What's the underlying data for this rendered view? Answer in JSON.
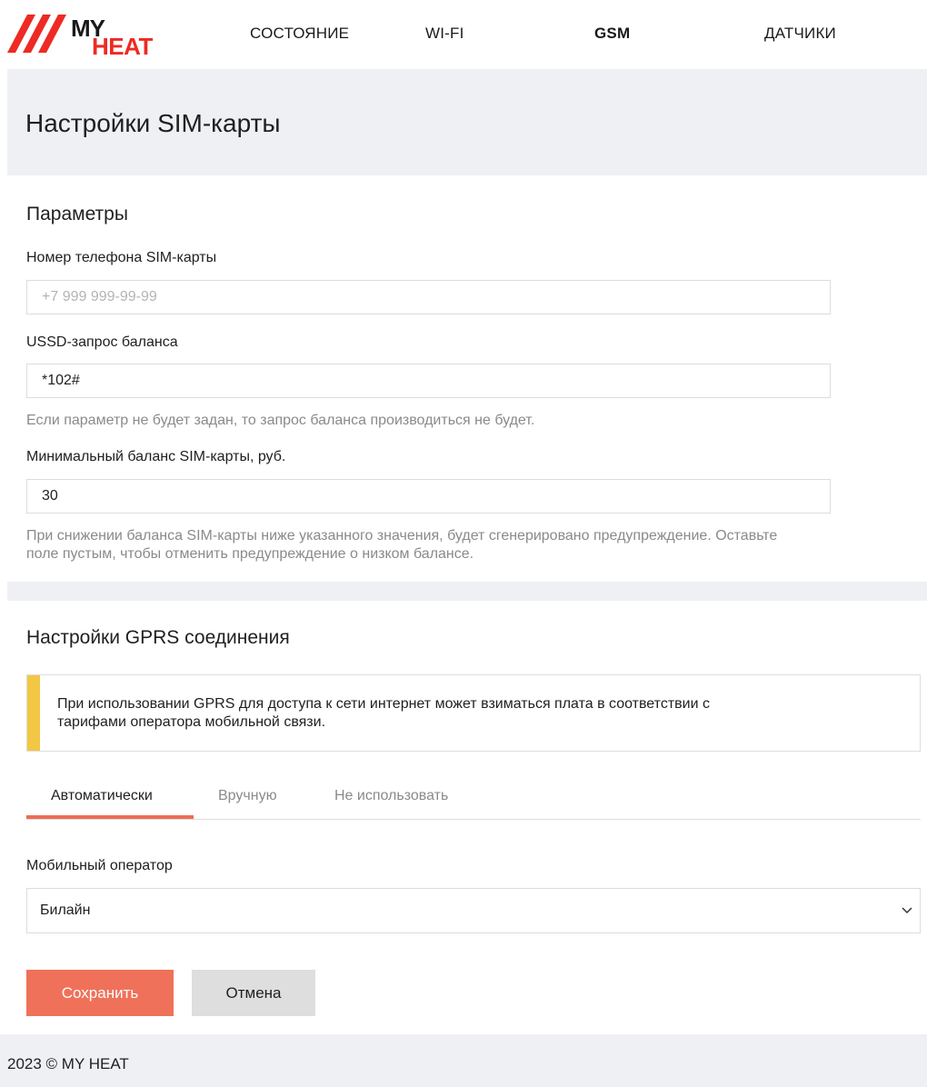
{
  "brand": {
    "logo_text_top": "MY",
    "logo_text_bottom": "HEAT",
    "accent_color": "#ee2a24"
  },
  "nav": {
    "items": [
      {
        "label": "СОСТОЯНИЕ"
      },
      {
        "label": "WI-FI"
      },
      {
        "label": "GSM"
      },
      {
        "label": "ДАТЧИКИ"
      }
    ],
    "active": "GSM"
  },
  "page": {
    "title": "Настройки SIM-карты"
  },
  "params": {
    "section_title": "Параметры",
    "phone": {
      "label": "Номер телефона SIM-карты",
      "value": "",
      "placeholder": "+7 999 999-99-99"
    },
    "ussd": {
      "label": "USSD-запрос баланса",
      "value": "*102#",
      "hint": "Если параметр не будет задан, то запрос баланса производиться не будет."
    },
    "min_balance": {
      "label": "Минимальный баланс SIM-карты, руб.",
      "value": "30",
      "hint_line1": "При снижении баланса SIM-карты ниже указанного значения, будет сгенерировано предупреждение. Оставьте",
      "hint_line2": "поле пустым, чтобы отменить предупреждение о низком балансе."
    }
  },
  "gprs": {
    "section_title": "Настройки GPRS соединения",
    "warning_line1": "При использовании GPRS для доступа к сети интернет может взиматься плата в соответствии с",
    "warning_line2": "тарифами оператора мобильной связи.",
    "warning_color": "#f2c744",
    "tabs": [
      {
        "label": "Автоматически"
      },
      {
        "label": "Вручную"
      },
      {
        "label": "Не использовать"
      }
    ],
    "active_tab": "Автоматически",
    "tab_accent": "#ee6c55",
    "operator": {
      "label": "Мобильный оператор",
      "value": "Билайн"
    }
  },
  "actions": {
    "save_label": "Сохранить",
    "cancel_label": "Отмена",
    "save_color": "#ef7159"
  },
  "footer": {
    "text": "2023 © MY HEAT"
  }
}
